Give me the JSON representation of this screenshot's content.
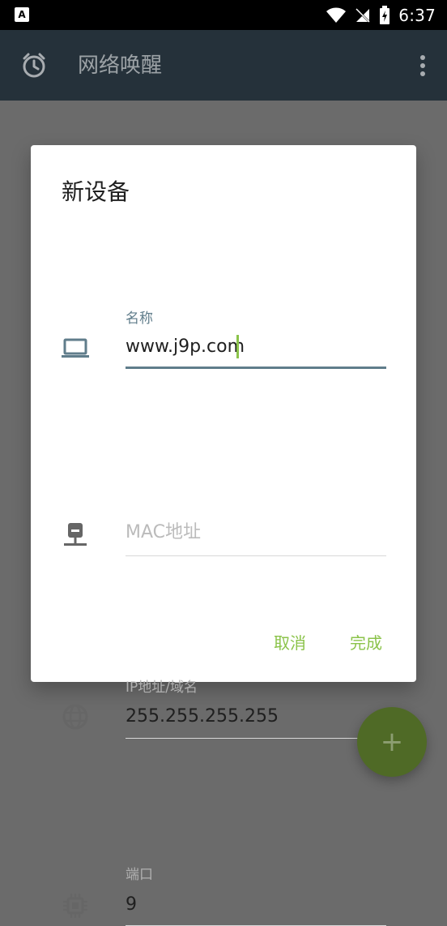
{
  "status": {
    "time": "6:37",
    "app_badge": "A"
  },
  "app_bar": {
    "title": "网络唤醒"
  },
  "dialog": {
    "title": "新设备",
    "fields": {
      "name": {
        "label": "名称",
        "value": "www.j9p.com"
      },
      "mac": {
        "placeholder": "MAC地址",
        "value": ""
      },
      "ip": {
        "label": "IP地址/域名",
        "value": "255.255.255.255"
      },
      "port": {
        "label": "端口",
        "value": "9"
      }
    },
    "buttons": {
      "cancel": "取消",
      "done": "完成"
    }
  },
  "fab": {
    "label": "+"
  },
  "colors": {
    "accent": "#8bc34a",
    "field_focus": "#607d8b",
    "app_bar": "#25313a",
    "scrim": "#6b6b6b",
    "fab": "#4f6a26"
  },
  "icons": {
    "app_icon": "alarm-icon",
    "more_icon": "more-vert-icon",
    "name_icon": "laptop-icon",
    "mac_icon": "network-device-icon",
    "ip_icon": "globe-icon",
    "port_icon": "chip-icon",
    "wifi_icon": "wifi-icon",
    "signal_icon": "no-signal-icon",
    "battery_icon": "battery-charging-icon"
  }
}
